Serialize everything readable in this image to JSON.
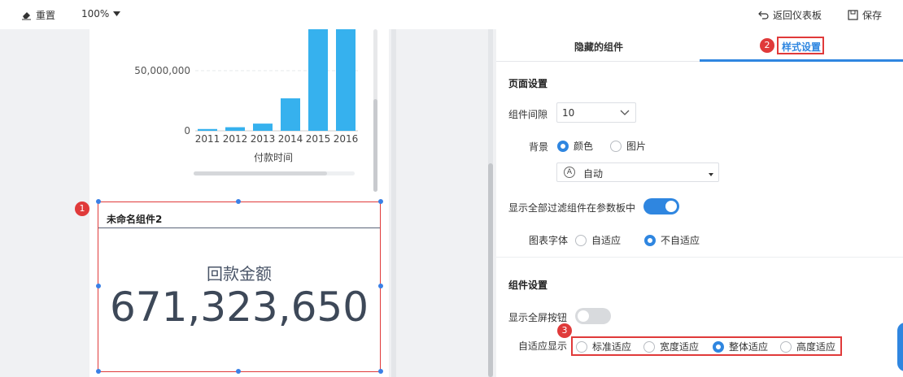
{
  "toolbar": {
    "reset_label": "重置",
    "zoom": "100%",
    "return_label": "返回仪表板",
    "save_label": "保存"
  },
  "chart_data": {
    "type": "bar",
    "categories": [
      "2011",
      "2012",
      "2013",
      "2014",
      "2015",
      "2016"
    ],
    "values": [
      1500000,
      3000000,
      6000000,
      27000000,
      100000000,
      100000000
    ],
    "xlabel": "付款时间",
    "ylabel": "",
    "ylim": [
      0,
      100000000
    ],
    "yticks": [
      "0",
      "50,000,000"
    ],
    "color": "#36b1ee",
    "grid": true
  },
  "widget": {
    "title": "未命名组件2",
    "kpi_label": "回款金额",
    "kpi_value": "671,323,650"
  },
  "badges": {
    "one": "1",
    "two": "2",
    "three": "3"
  },
  "side": {
    "tab_hidden": "隐藏的组件",
    "tab_style": "样式设置",
    "page_settings": "页面设置",
    "gap_label": "组件间隙",
    "gap_value": "10",
    "bg_label": "背景",
    "bg_color": "颜色",
    "bg_image": "图片",
    "auto_glyph": "A",
    "auto_label": "自动",
    "show_filters_label": "显示全部过滤组件在参数板中",
    "font_label": "图表字体",
    "font_adaptive": "自适应",
    "font_not_adaptive": "不自适应",
    "component_settings": "组件设置",
    "fullscreen_label": "显示全屏按钮",
    "adapt_label": "自适应显示",
    "adapt_standard": "标准适应",
    "adapt_width": "宽度适应",
    "adapt_whole": "整体适应",
    "adapt_height": "高度适应"
  },
  "colors": {
    "accent": "#2f86e0",
    "highlight": "#e03a3a",
    "bar": "#36b1ee"
  }
}
